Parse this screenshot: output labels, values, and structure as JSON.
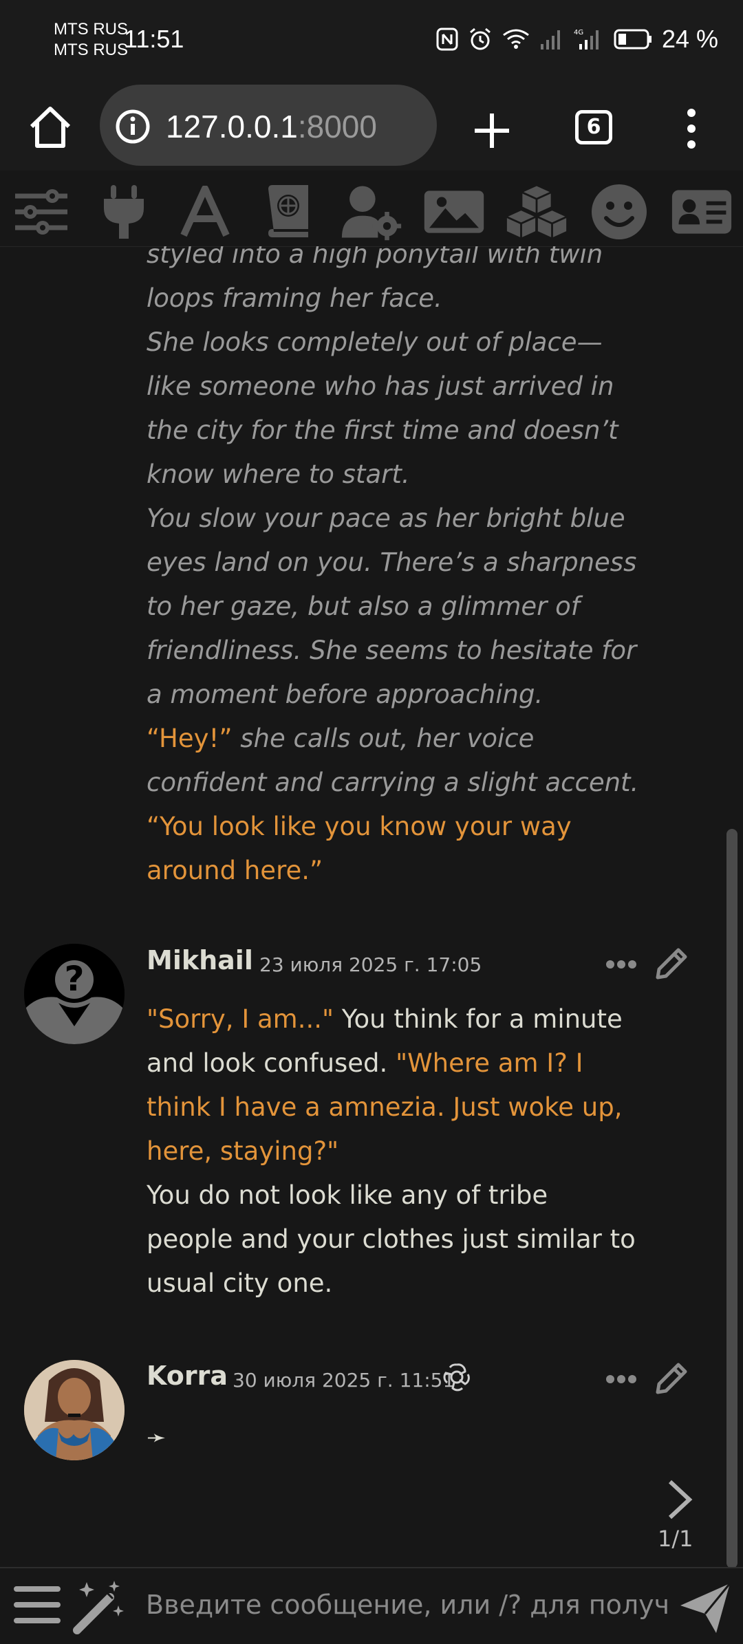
{
  "status": {
    "carrier1": "MTS RUS",
    "carrier2": "MTS RUS",
    "time": "11:51",
    "battery": "24 %"
  },
  "browser": {
    "url_host": "127.0.0.1",
    "url_port": ":8000",
    "tab_count": "6"
  },
  "toolbar": {
    "icons": [
      "sliders-icon",
      "plug-icon",
      "font-icon",
      "book-globe-icon",
      "user-gear-icon",
      "image-icon",
      "cubes-icon",
      "smiley-icon",
      "id-card-icon"
    ]
  },
  "prev_message": {
    "line_partial": "styled into a high ponytail with twin",
    "p1_end": "loops framing her face.",
    "p2": "She looks completely out of place—like someone who has just arrived in the city for the first time and doesn’t know where to start.",
    "p3": "You slow your pace as her bright blue eyes land on you. There’s a sharpness to her gaze, but also a glimmer of friendliness. She seems to hesitate for a moment before approaching.",
    "p4_quote": "“Hey!”",
    "p4_rest": " she calls out, her voice confident and carrying a slight accent.",
    "p5_quote": "“You look like you know your way around here.”"
  },
  "messages": [
    {
      "name": "Mikhail",
      "timestamp": "23 июля 2025 г. 17:05",
      "q1": "\"Sorry, I am...\"",
      "t1": " You think for a minute and look confused. ",
      "q2": "\"Where am I? I think I have a amnezia. Just woke up, here, staying?\"",
      "t2": "You do not look like any of tribe people and your clothes just similar to usual city one."
    },
    {
      "name": "Korra",
      "timestamp": "30 июля 2025 г. 11:51",
      "model_icon": "openai-icon",
      "text": "➛"
    }
  ],
  "swipe": {
    "counter": "1/1"
  },
  "input": {
    "placeholder": "Введите сообщение, или /? для получ"
  },
  "colors": {
    "bg": "#171717",
    "quote": "#e3943a",
    "italic": "#9a9a9a",
    "text": "#dcdcd2"
  }
}
